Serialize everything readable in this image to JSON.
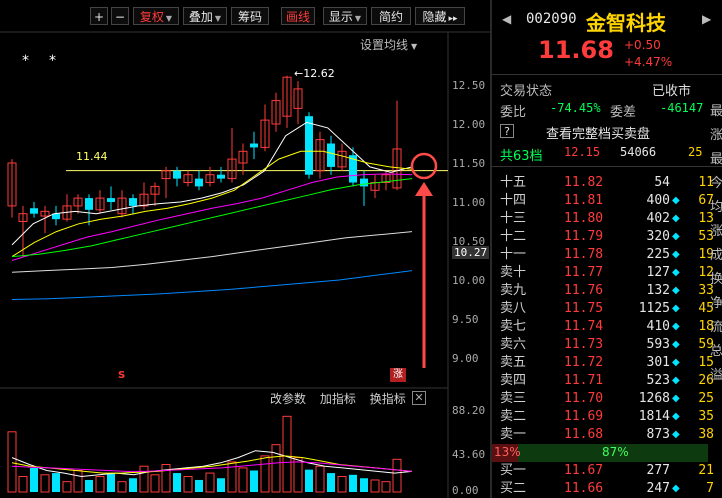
{
  "toolbar": {
    "plus": "+",
    "minus": "−",
    "fuquan": "复权",
    "diejia": "叠加",
    "chouma": "筹码",
    "huaxian": "画线",
    "xianshi": "显示",
    "jianyue": "简约",
    "yincang": "隐藏",
    "more": "▸▸"
  },
  "chart": {
    "setting_ma": "设置均线",
    "high_label": "12.62",
    "hline_label": "11.44",
    "price_axis": [
      "12.50",
      "12.00",
      "11.50",
      "11.00",
      "10.50",
      "10.27",
      "10.00",
      "9.50",
      "9.00"
    ],
    "price_box": "10.27",
    "limit_up_tag": "涨",
    "s_tag": "S",
    "star": "*",
    "indicator_bar": {
      "params": "改参数",
      "add": "加指标",
      "switch": "换指标",
      "close": "✕"
    },
    "vol_axis": [
      "88.20",
      "43.60",
      "0.00"
    ],
    "colors": {
      "up": "#ff3b3b",
      "down": "#00e5ff",
      "ma5": "#ffffff",
      "ma10": "#ffff00",
      "ma20": "#ff00ff",
      "ma30": "#00ff00",
      "ma60": "#dddddd",
      "ma120": "#0088ff",
      "annotation": "#ff4a4a"
    }
  },
  "quote": {
    "prev_arrow": "◀",
    "next_arrow": "▶",
    "code": "002090",
    "name": "金智科技",
    "price": "11.68",
    "change": "+0.50",
    "change_pct": "+4.47%",
    "trade_status_label": "交易状态",
    "trade_status": "已收市",
    "weibi_label": "委比",
    "weibi": "-74.45%",
    "weicha_label": "委差",
    "weicha": "-46147",
    "help": "?",
    "full_book": "查看完整档买卖盘",
    "total_label": "共63档",
    "total_price": "12.15",
    "total_vol": "54066",
    "total_count": "25",
    "ratio_left": "13%",
    "ratio_right": "87%",
    "side_chars": [
      "最",
      "涨",
      "最",
      "今",
      "均",
      "涨",
      "成",
      "换",
      "净",
      "流",
      "总",
      "溢"
    ]
  },
  "asks": [
    {
      "level": "十五",
      "price": "11.82",
      "vol": "54",
      "count": "11",
      "dia": false
    },
    {
      "level": "十四",
      "price": "11.81",
      "vol": "400",
      "count": "67",
      "dia": true
    },
    {
      "level": "十三",
      "price": "11.80",
      "vol": "402",
      "count": "13",
      "dia": true
    },
    {
      "level": "十二",
      "price": "11.79",
      "vol": "320",
      "count": "53",
      "dia": true
    },
    {
      "level": "十一",
      "price": "11.78",
      "vol": "225",
      "count": "19",
      "dia": true
    },
    {
      "level": "卖十",
      "price": "11.77",
      "vol": "127",
      "count": "12",
      "dia": true
    },
    {
      "level": "卖九",
      "price": "11.76",
      "vol": "132",
      "count": "33",
      "dia": true
    },
    {
      "level": "卖八",
      "price": "11.75",
      "vol": "1125",
      "count": "45",
      "dia": true
    },
    {
      "level": "卖七",
      "price": "11.74",
      "vol": "410",
      "count": "18",
      "dia": true
    },
    {
      "level": "卖六",
      "price": "11.73",
      "vol": "593",
      "count": "59",
      "dia": true
    },
    {
      "level": "卖五",
      "price": "11.72",
      "vol": "301",
      "count": "15",
      "dia": true
    },
    {
      "level": "卖四",
      "price": "11.71",
      "vol": "523",
      "count": "26",
      "dia": true
    },
    {
      "level": "卖三",
      "price": "11.70",
      "vol": "1268",
      "count": "25",
      "dia": true
    },
    {
      "level": "卖二",
      "price": "11.69",
      "vol": "1814",
      "count": "35",
      "dia": true
    },
    {
      "level": "卖一",
      "price": "11.68",
      "vol": "873",
      "count": "38",
      "dia": true
    }
  ],
  "bids": [
    {
      "level": "买一",
      "price": "11.67",
      "vol": "277",
      "count": "21",
      "dia": false
    },
    {
      "level": "买二",
      "price": "11.66",
      "vol": "247",
      "count": "7",
      "dia": true
    }
  ]
}
